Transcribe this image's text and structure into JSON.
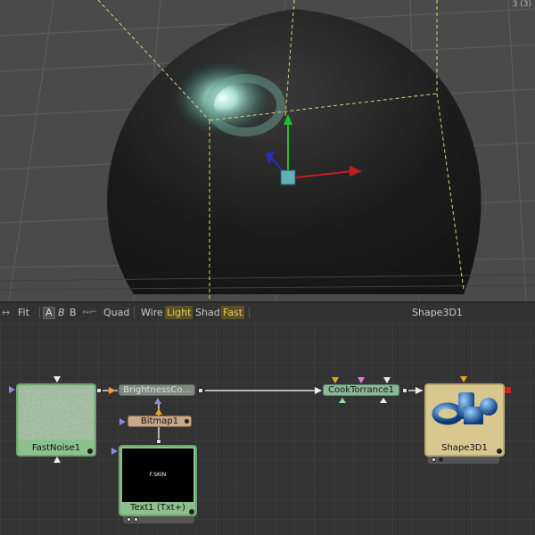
{
  "viewport": {
    "corner_label": "3 (3)",
    "colors": {
      "grid": "#5a5a5a",
      "bg": "#4a4a4a",
      "sphere": "#1a1a1a"
    }
  },
  "toolbar": {
    "fit": "Fit",
    "a": "A",
    "b_italic": "B",
    "b": "B",
    "quad": "Quad",
    "wire": "Wire",
    "light": "Light",
    "shad": "Shad",
    "fast": "Fast",
    "view_name": "Shape3D1"
  },
  "nodes": {
    "fastnoise": {
      "label": "FastNoise1"
    },
    "brightness": {
      "label": "BrightnessCo..."
    },
    "bitmap": {
      "label": "Bitmap1"
    },
    "text": {
      "label": "Text1  (Txt+)",
      "preview_text": "F.SKIN"
    },
    "cooktorrance": {
      "label": "CookTorrance1"
    },
    "shape3d": {
      "label": "Shape3D1"
    }
  },
  "colors": {
    "tile_green": "#8cc08c",
    "tool_gray": "#8a9a8a",
    "bitmap_tan": "#c8a888",
    "shape_tan": "#d8c890",
    "wire": "#dddddd",
    "accent_orange": "#f0a020"
  }
}
